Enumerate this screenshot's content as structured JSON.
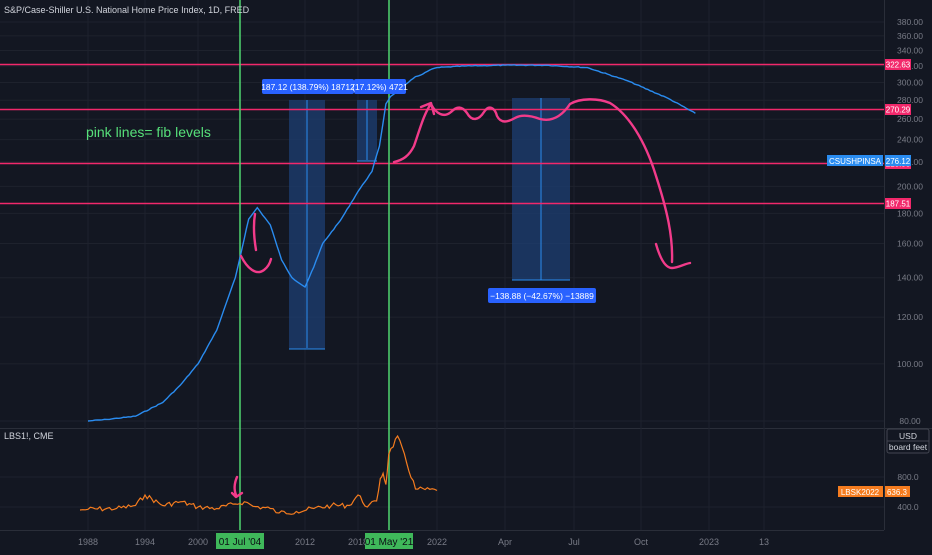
{
  "header": {
    "main_title": "S&P/Case-Shiller U.S. National Home Price Index, 1D, FRED",
    "sub_title": "LBS1!, CME"
  },
  "colors": {
    "background": "#131722",
    "grid": "#1e222d",
    "axis_text": "#787b86",
    "hpi_line": "#2a8cf0",
    "lumber_line": "#f57c1f",
    "fib_line": "#f2286b",
    "vertical_marker": "#4fd670",
    "measure_box": "#1e3f73",
    "measure_label": "#2962ff",
    "annotation_text": "#57e07a",
    "pen": "#f23b8a"
  },
  "annotation": {
    "text": "pink lines= fib levels"
  },
  "measure_labels": [
    "187.12 (138.79%) 18712",
    "(17.12%) 4721",
    "−138.88 (−42.67%) −13889"
  ],
  "unit_box": {
    "unit": "USD",
    "measure": "board feet"
  },
  "chart_data": [
    {
      "type": "line",
      "title": "S&P/Case-Shiller U.S. National Home Price Index, 1D, FRED",
      "scale": "log",
      "y_ticks": [
        80,
        100,
        120,
        140,
        160,
        180,
        200,
        220,
        240,
        260,
        280,
        300,
        320,
        340,
        360,
        380
      ],
      "y_tick_labels": [
        "80.00",
        "100.00",
        "120.00",
        "140.00",
        "160.00",
        "180.00",
        "200.00",
        "220.00",
        "240.00",
        "260.00",
        "280.00",
        "300.00",
        "320.00",
        "340.00",
        "360.00",
        "380.00"
      ],
      "ylim": [
        78,
        395
      ],
      "x_tick_labels": [
        "1988",
        "1994",
        "2000",
        "01 Jul '04",
        "2012",
        "2018",
        "01 May '21",
        "2022",
        "Apr",
        "Jul",
        "Oct",
        "2023",
        "13"
      ],
      "highlighted_x_labels": [
        "01 Jul '04",
        "01 May '21"
      ],
      "fib_levels": [
        322.63,
        270.29,
        218.98,
        187.51
      ],
      "fib_level_labels": [
        "322.63",
        "270.29",
        "218.98",
        "187.51"
      ],
      "series": [
        {
          "name": "CSUSHPINSA",
          "last_value": 276.12,
          "last_value_label": "276.12",
          "x": [
            1988,
            1990,
            1993,
            1996,
            1998,
            2000,
            2002,
            2004,
            2005.5,
            2006.5,
            2008,
            2009.3,
            2010.5,
            2012,
            2013,
            2014,
            2016,
            2018,
            2019.5,
            2020.3,
            2021,
            2021.35,
            2021.6,
            2021.7,
            2021.8,
            2021.9,
            2022,
            2022.1,
            2022.25,
            2022.4,
            2022.55,
            2022.7,
            2022.85,
            2022.95
          ],
          "values": [
            80,
            80.5,
            81.5,
            86,
            92,
            100,
            114,
            140,
            176,
            184,
            172,
            150,
            140,
            135,
            146,
            160,
            175,
            196,
            212,
            234,
            276,
            284,
            300,
            307,
            310,
            315,
            318,
            320,
            321,
            321,
            318,
            302,
            282,
            266
          ]
        }
      ]
    },
    {
      "type": "line",
      "title": "LBS1!, CME",
      "y_ticks": [
        400,
        800
      ],
      "y_tick_labels": [
        "400.0",
        "800.0"
      ],
      "ylim": [
        180,
        1150
      ],
      "series": [
        {
          "name": "LBSK2022",
          "last_value": 636.3,
          "last_value_label": "636.3",
          "x": [
            1986,
            1988,
            1991,
            1993,
            1994,
            1996,
            1998,
            2000,
            2002,
            2004,
            2005,
            2006,
            2008,
            2009,
            2011,
            2013,
            2015,
            2017,
            2018,
            2019,
            2020,
            2020.4,
            2020.7,
            2021,
            2021.3,
            2021.45,
            2021.7,
            2022
          ],
          "values": [
            360,
            370,
            380,
            420,
            560,
            420,
            470,
            400,
            380,
            440,
            470,
            410,
            380,
            320,
            340,
            380,
            420,
            420,
            560,
            400,
            480,
            780,
            850,
            700,
            1100,
            1600,
            640,
            620
          ]
        }
      ]
    }
  ]
}
